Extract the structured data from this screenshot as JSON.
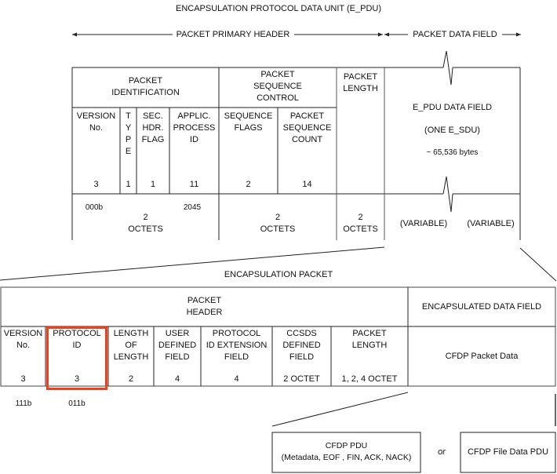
{
  "title": "ENCAPSULATION PROTOCOL DATA UNIT (E_PDU)",
  "spans": {
    "primary_header": "PACKET PRIMARY HEADER",
    "data_field": "PACKET DATA FIELD"
  },
  "epdu": {
    "groups": {
      "identification": "PACKET\nIDENTIFICATION",
      "sequence_control": "PACKET\nSEQUENCE\nCONTROL",
      "length": "PACKET\nLENGTH"
    },
    "fields": [
      {
        "label": "VERSION\nNo.",
        "bits": "3"
      },
      {
        "label": "T\nY\nP\nE",
        "bits": "1"
      },
      {
        "label": "SEC.\nHDR.\nFLAG",
        "bits": "1"
      },
      {
        "label": "APPLIC.\nPROCESS\nID",
        "bits": "11"
      },
      {
        "label": "SEQUENCE\nFLAGS",
        "bits": "2"
      },
      {
        "label": "PACKET\nSEQUENCE\nCOUNT",
        "bits": "14"
      }
    ],
    "data_field": {
      "title": "E_PDU DATA FIELD",
      "subtitle": "(ONE E_SDU)",
      "size": "~ 65,536 bytes",
      "variable_left": "(VARIABLE)",
      "variable_right": "(VARIABLE)"
    },
    "bottom": {
      "version_value": "000b",
      "apid_value": "2045",
      "ident_octets": "2\nOCTETS",
      "seq_octets": "2\nOCTETS",
      "length_octets": "2\nOCTETS"
    }
  },
  "encap": {
    "title": "ENCAPSULATION PACKET",
    "header_label": "PACKET\nHEADER",
    "data_field_label": "ENCAPSULATED DATA FIELD",
    "data_content": "CFDP Packet Data",
    "fields": [
      {
        "label": "VERSION\nNo.",
        "size": "3"
      },
      {
        "label": "PROTOCOL\nID",
        "size": "3"
      },
      {
        "label": "LENGTH\nOF\nLENGTH",
        "size": "2"
      },
      {
        "label": "USER\nDEFINED\nFIELD",
        "size": "4"
      },
      {
        "label": "PROTOCOL\nID EXTENSION\nFIELD",
        "size": "4"
      },
      {
        "label": "CCSDS\nDEFINED\nFIELD",
        "size": "2 OCTET"
      },
      {
        "label": "PACKET\nLENGTH",
        "size": "1, 2, 4 OCTET"
      }
    ],
    "values": {
      "version": "111b",
      "protocol_id": "011b"
    },
    "highlight_color": "#f0401a"
  },
  "cfdp": {
    "pdu_label": "CFDP PDU\n(Metadata, EOF , FIN, ACK, NACK)",
    "or_label": "or",
    "file_data_label": "CFDP File Data PDU"
  }
}
